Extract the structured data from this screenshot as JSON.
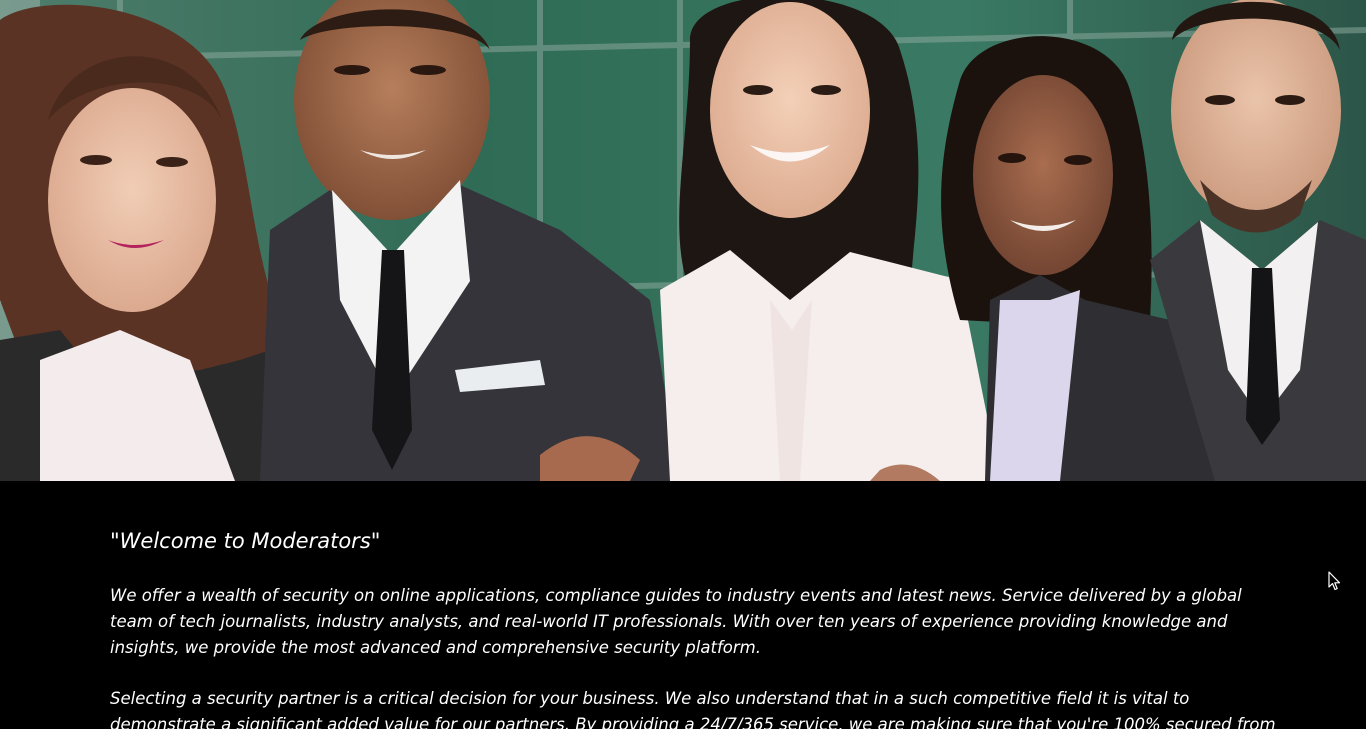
{
  "hero": {
    "image": "team-of-five-business-professionals-photo"
  },
  "intro": {
    "heading": "\"Welcome to Moderators\"",
    "paragraph_1": "We offer a wealth of security on online applications, compliance guides to industry events and latest news. Service delivered by a global team of tech journalists, industry analysts, and real-world IT professionals. With over ten years of experience providing knowledge and insights, we provide the most advanced and comprehensive security platform.",
    "paragraph_2": "Selecting a security partner is a critical decision for your business. We also understand that in a such competitive field it is vital to demonstrate a significant added value for our partners. By providing a 24/7/365 service, we are making sure that you're 100% secured from any threats. We do our best"
  },
  "colors": {
    "background": "#000000",
    "text": "#ffffff",
    "hero_backdrop": "#2f5a4c"
  },
  "cursor": {
    "icon": "mouse-pointer-icon"
  }
}
